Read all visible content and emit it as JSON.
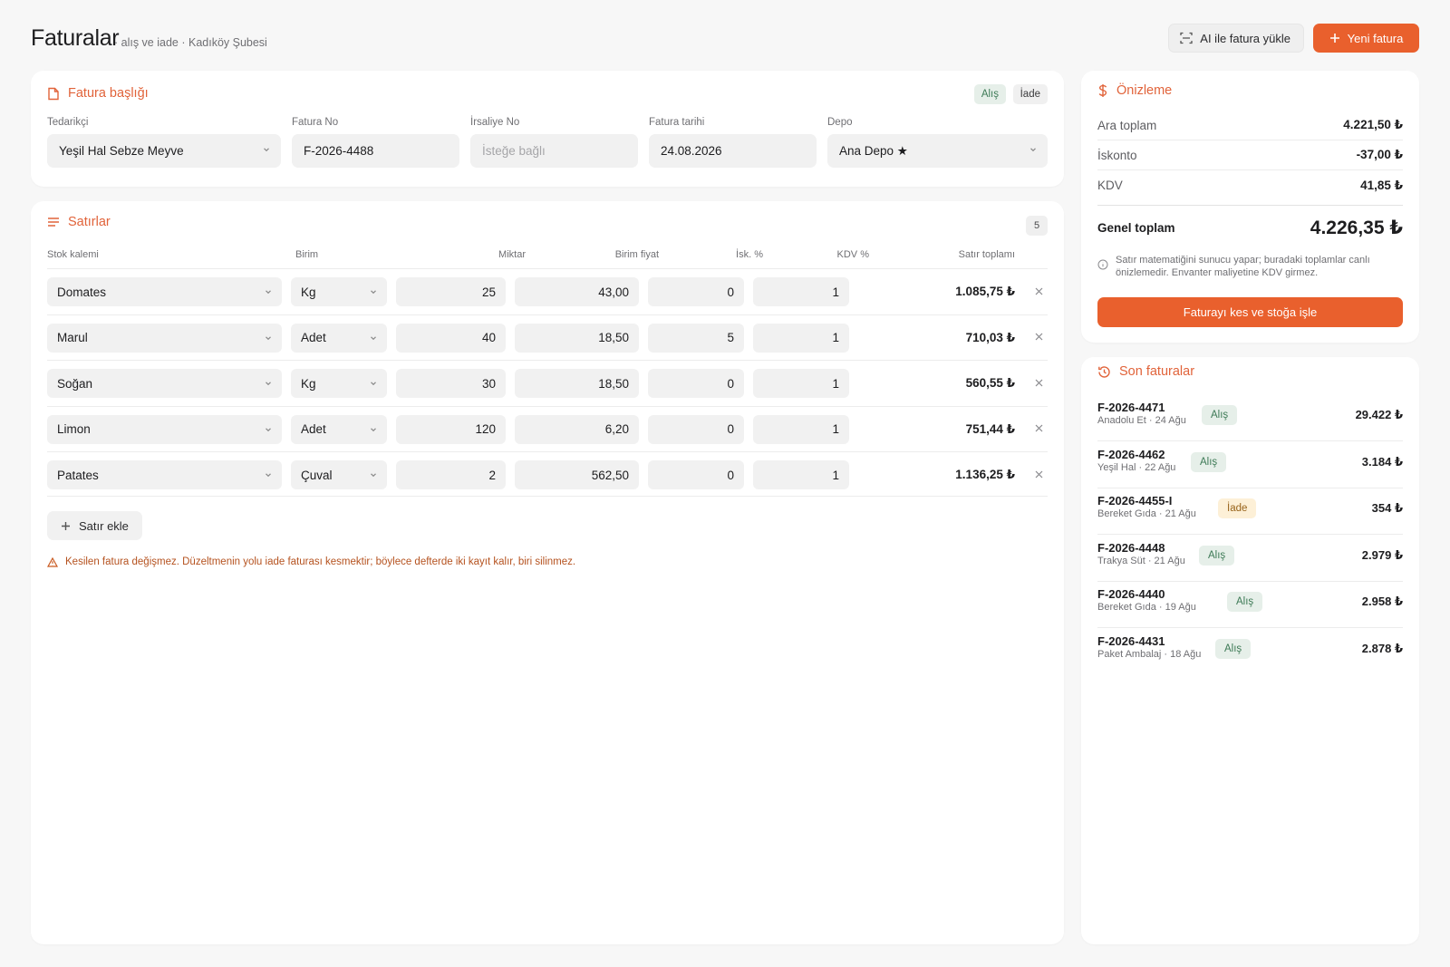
{
  "header": {
    "title": "Faturalar",
    "subtitle": "· alış ve iade · Kadıköy Şubesi",
    "ai_upload_label": "AI ile fatura yükle",
    "new_invoice_label": "Yeni fatura"
  },
  "invoice_header": {
    "title": "Fatura başlığı",
    "type_alis": "Alış",
    "type_iade": "İade",
    "selected_type": "Alış",
    "fields": {
      "supplier": {
        "label": "Tedarikçi",
        "value": "Yeşil Hal Sebze Meyve"
      },
      "invoice_no": {
        "label": "Fatura No",
        "value": "F-2026-4488"
      },
      "waybill_no": {
        "label": "İrsaliye No",
        "placeholder": "İsteğe bağlı"
      },
      "invoice_date": {
        "label": "Fatura tarihi",
        "value": "24.08.2026"
      },
      "warehouse": {
        "label": "Depo",
        "value": "Ana Depo ★"
      }
    }
  },
  "lines": {
    "title": "Satırlar",
    "count": "5",
    "columns": {
      "item": "Stok kalemi",
      "unit": "Birim",
      "qty": "Miktar",
      "price": "Birim fiyat",
      "discount": "İsk. %",
      "vat": "KDV %",
      "total": "Satır toplamı"
    },
    "rows": [
      {
        "item": "Domates",
        "unit": "Kg",
        "qty": "25",
        "price": "43,00",
        "discount": "0",
        "vat": "1",
        "total": "1.085,75 ₺"
      },
      {
        "item": "Marul",
        "unit": "Adet",
        "qty": "40",
        "price": "18,50",
        "discount": "5",
        "vat": "1",
        "total": "710,03 ₺"
      },
      {
        "item": "Soğan",
        "unit": "Kg",
        "qty": "30",
        "price": "18,50",
        "discount": "0",
        "vat": "1",
        "total": "560,55 ₺"
      },
      {
        "item": "Limon",
        "unit": "Adet",
        "qty": "120",
        "price": "6,20",
        "discount": "0",
        "vat": "1",
        "total": "751,44 ₺"
      },
      {
        "item": "Patates",
        "unit": "Çuval",
        "qty": "2",
        "price": "562,50",
        "discount": "0",
        "vat": "1",
        "total": "1.136,25 ₺"
      }
    ],
    "add_row_label": "Satır ekle",
    "warning": "Kesilen fatura değişmez. Düzeltmenin yolu iade faturası kesmektir; böylece defterde iki kayıt kalır, biri silinmez."
  },
  "preview": {
    "title": "Önizleme",
    "subtotal_label": "Ara toplam",
    "subtotal": "4.221,50 ₺",
    "discount_label": "İskonto",
    "discount": "-37,00 ₺",
    "vat_label": "KDV",
    "vat": "41,85 ₺",
    "grand_label": "Genel toplam",
    "grand": "4.226,35 ₺",
    "note": "Satır matematiğini sunucu yapar; buradaki toplamlar canlı önizlemedir. Envanter maliyetine KDV girmez.",
    "commit_label": "Faturayı kes ve stoğa işle"
  },
  "recent": {
    "title": "Son faturalar",
    "items": [
      {
        "no": "F-2026-4471",
        "meta": "Anadolu Et · 24 Ağu",
        "type": "Alış",
        "amount": "29.422 ₺"
      },
      {
        "no": "F-2026-4462",
        "meta": "Yeşil Hal · 22 Ağu",
        "type": "Alış",
        "amount": "3.184 ₺"
      },
      {
        "no": "F-2026-4455-I",
        "meta": "Bereket Gıda · 21 Ağu",
        "type": "İade",
        "amount": "354 ₺"
      },
      {
        "no": "F-2026-4448",
        "meta": "Trakya Süt · 21 Ağu",
        "type": "Alış",
        "amount": "2.979 ₺"
      },
      {
        "no": "F-2026-4440",
        "meta": "Bereket Gıda · 19 Ağu",
        "type": "Alış",
        "amount": "2.958 ₺"
      },
      {
        "no": "F-2026-4431",
        "meta": "Paket Ambalaj · 18 Ağu",
        "type": "Alış",
        "amount": "2.878 ₺"
      }
    ]
  },
  "colors": {
    "accent": "#e9602d",
    "alis_bg": "#e6efe9",
    "iade_bg": "#fdf0d7",
    "warning": "#b5521f"
  }
}
